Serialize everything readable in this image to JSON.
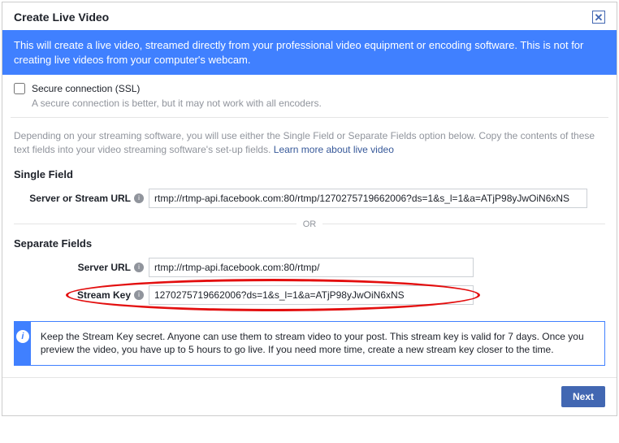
{
  "header": {
    "title": "Create Live Video"
  },
  "banner": {
    "text": "This will create a live video, streamed directly from your professional video equipment or encoding software. This is not for creating live videos from your computer's webcam."
  },
  "ssl": {
    "label": "Secure connection (SSL)",
    "sub": "A secure connection is better, but it may not work with all encoders."
  },
  "instructions": {
    "text": "Depending on your streaming software, you will use either the Single Field or Separate Fields option below. Copy the contents of these text fields into your video streaming software's set-up fields. ",
    "link": "Learn more about live video"
  },
  "single_field": {
    "title": "Single Field",
    "label": "Server or Stream URL",
    "value": "rtmp://rtmp-api.facebook.com:80/rtmp/1270275719662006?ds=1&s_l=1&a=ATjP98yJwOiN6xNS"
  },
  "or_label": "OR",
  "separate_fields": {
    "title": "Separate Fields",
    "server_label": "Server URL",
    "server_value": "rtmp://rtmp-api.facebook.com:80/rtmp/",
    "key_label": "Stream Key",
    "key_value": "1270275719662006?ds=1&s_l=1&a=ATjP98yJwOiN6xNS"
  },
  "info_box": {
    "text": "Keep the Stream Key secret. Anyone can use them to stream video to your post. This stream key is valid for 7 days. Once you preview the video, you have up to 5 hours to go live. If you need more time, create a new stream key closer to the time."
  },
  "footer": {
    "next": "Next"
  }
}
